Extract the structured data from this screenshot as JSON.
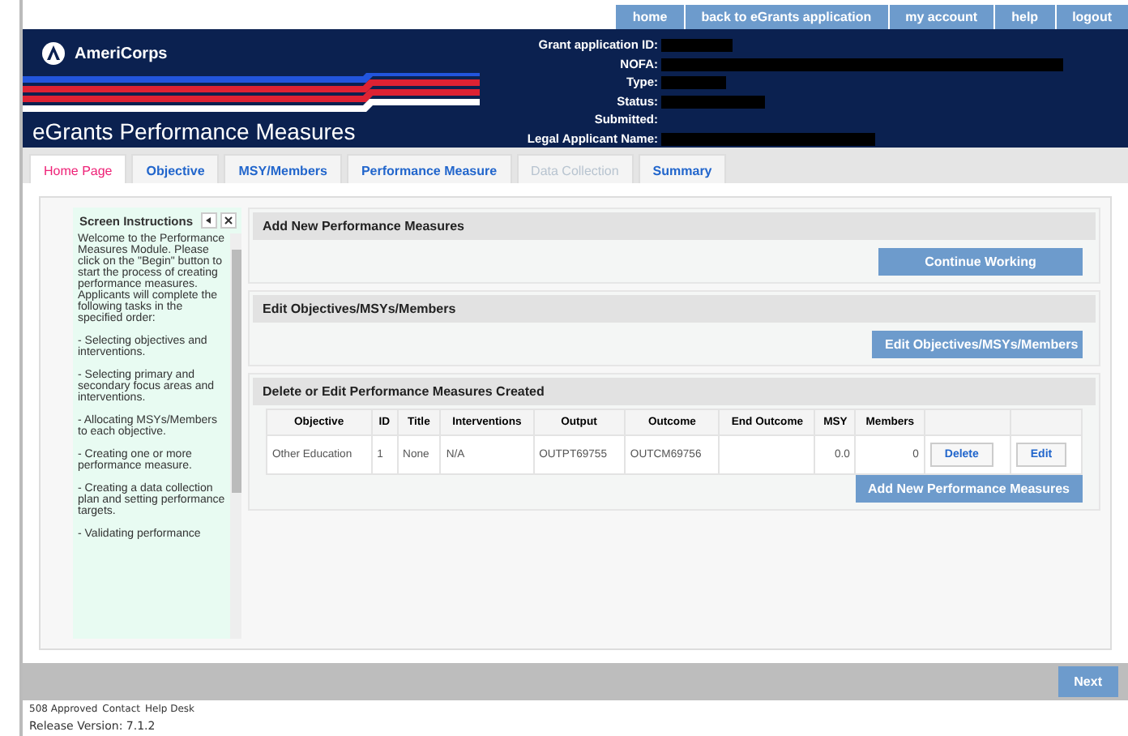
{
  "top_nav": [
    "home",
    "back to eGrants application",
    "my account",
    "help",
    "logout"
  ],
  "header": {
    "brand": "AmeriCorps",
    "title": "eGrants Performance Measures",
    "fields": [
      {
        "label": "Grant application ID:",
        "redacted": true
      },
      {
        "label": "NOFA:",
        "redacted": true
      },
      {
        "label": "Type:",
        "redacted": true
      },
      {
        "label": "Status:",
        "redacted": true
      },
      {
        "label": "Submitted:",
        "redacted": false
      },
      {
        "label": "Legal Applicant Name:",
        "redacted": true
      }
    ]
  },
  "tabs": [
    {
      "label": "Home Page",
      "selected": true,
      "disabled": false
    },
    {
      "label": "Objective",
      "selected": false,
      "disabled": false
    },
    {
      "label": "MSY/Members",
      "selected": false,
      "disabled": false
    },
    {
      "label": "Performance Measure",
      "selected": false,
      "disabled": false
    },
    {
      "label": "Data Collection",
      "selected": false,
      "disabled": true
    },
    {
      "label": "Summary",
      "selected": false,
      "disabled": false
    }
  ],
  "instructions": {
    "title": "Screen Instructions",
    "paragraphs": [
      "Welcome to the Performance Measures Module. Please click on the \"Begin\" button to start the process of creating performance measures. Applicants will complete the following tasks in the specified order:",
      "- Selecting objectives and interventions.",
      "- Selecting primary and secondary focus areas and interventions.",
      "- Allocating MSYs/Members to each objective.",
      "- Creating one or more performance measure.",
      "- Creating a data collection plan and setting performance targets.",
      "- Validating performance"
    ]
  },
  "sections": [
    {
      "title": "Add New Performance Measures",
      "button": "Continue Working"
    },
    {
      "title": "Edit Objectives/MSYs/Members",
      "button": "Edit Objectives/MSYs/Members"
    }
  ],
  "table_section": {
    "title": "Delete or Edit Performance Measures Created",
    "columns": [
      "Objective",
      "ID",
      "Title",
      "Interventions",
      "Output",
      "Outcome",
      "End Outcome",
      "MSY",
      "Members"
    ],
    "rows": [
      {
        "cells": [
          "Other Education",
          "1",
          "None",
          "N/A",
          "OUTPT69755",
          "OUTCM69756",
          "",
          "0.0",
          "0"
        ],
        "actions": [
          "Delete",
          "Edit"
        ]
      }
    ],
    "button": "Add New Performance Measures"
  },
  "next_button": "Next",
  "footer": {
    "links": [
      "508 Approved",
      "Contact",
      "Help Desk"
    ],
    "release": "Release Version: 7.1.2"
  }
}
